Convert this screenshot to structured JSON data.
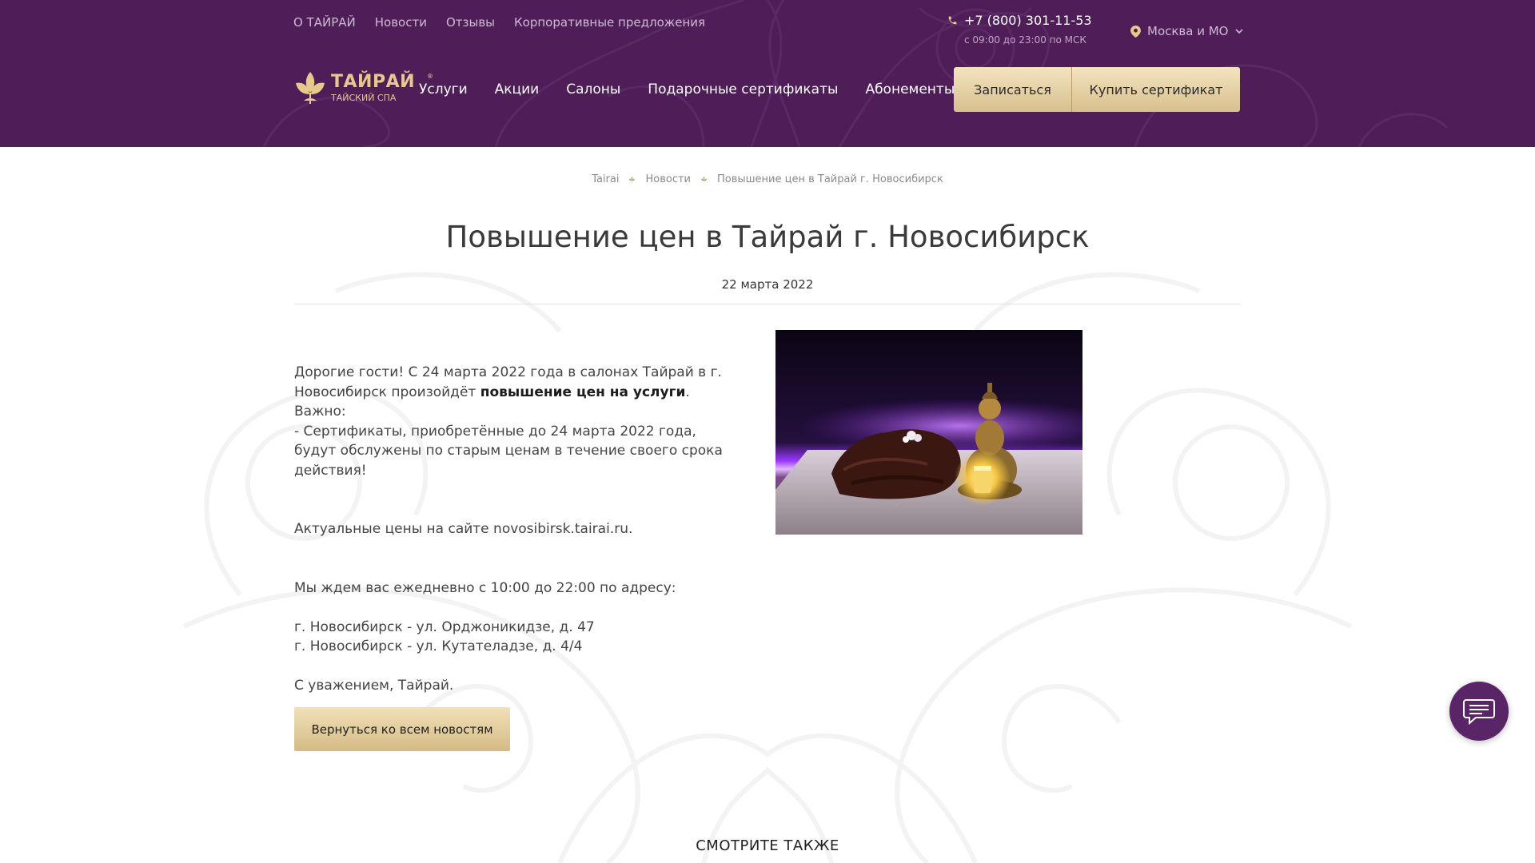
{
  "header": {
    "top_links": [
      "О ТАЙРАЙ",
      "Новости",
      "Отзывы",
      "Корпоративные предложения"
    ],
    "phone": "+7 (800) 301-11-53",
    "hours": "с 09:00 до 23:00 по МСК",
    "region": "Москва и МО",
    "logo_name": "ТАЙРАЙ",
    "logo_sub": "ТАЙСКИЙ СПА",
    "logo_reg": "®",
    "nav": [
      "Услуги",
      "Акции",
      "Салоны",
      "Подарочные сертификаты",
      "Абонементы"
    ],
    "book_label": "Записаться",
    "cert_label": "Купить сертификат",
    "colors": {
      "header_bg": "#4f1e59",
      "gold": "#e7c98c",
      "button": "#e2cfa0"
    }
  },
  "breadcrumb": [
    "Tairai",
    "Новости",
    "Повышение цен в Тайрай г. Новосибирск"
  ],
  "title": "Повышение цен в Тайрай г. Новосибирск",
  "date": "22 марта 2022",
  "article": {
    "intro_prefix": "Дорогие гости! С 24 марта 2022 года в салонах Тайрай в г. Новосибирск произойдёт ",
    "intro_bold": "повышение цен на услуги",
    "intro_suffix": ".",
    "important": "Важно:",
    "certificates": "- Сертификаты, приобретённые до 24 марта 2022 года, будут обслужены по старым ценам в течение своего срока действия!",
    "prices": "Актуальные цены на сайте novosibirsk.tairai.ru.",
    "waiting": "Мы ждем вас ежедневно с 10:00 до 22:00 по адресу:",
    "address_1": "г. Новосибирск - ул. Орджоникидзе, д. 47",
    "address_2": "г. Новосибирск - ул. Кутателадзе, д. 4/4",
    "regards": "С уважением, Тайрай."
  },
  "back_button": "Вернуться ко всем новостям",
  "see_also": "СМОТРИТЕ ТАКЖЕ",
  "icons": [
    "phone-icon",
    "location-pin-icon",
    "chevron-down-icon",
    "lotus-logo-icon",
    "breadcrumb-separator-icon",
    "chat-icon"
  ]
}
